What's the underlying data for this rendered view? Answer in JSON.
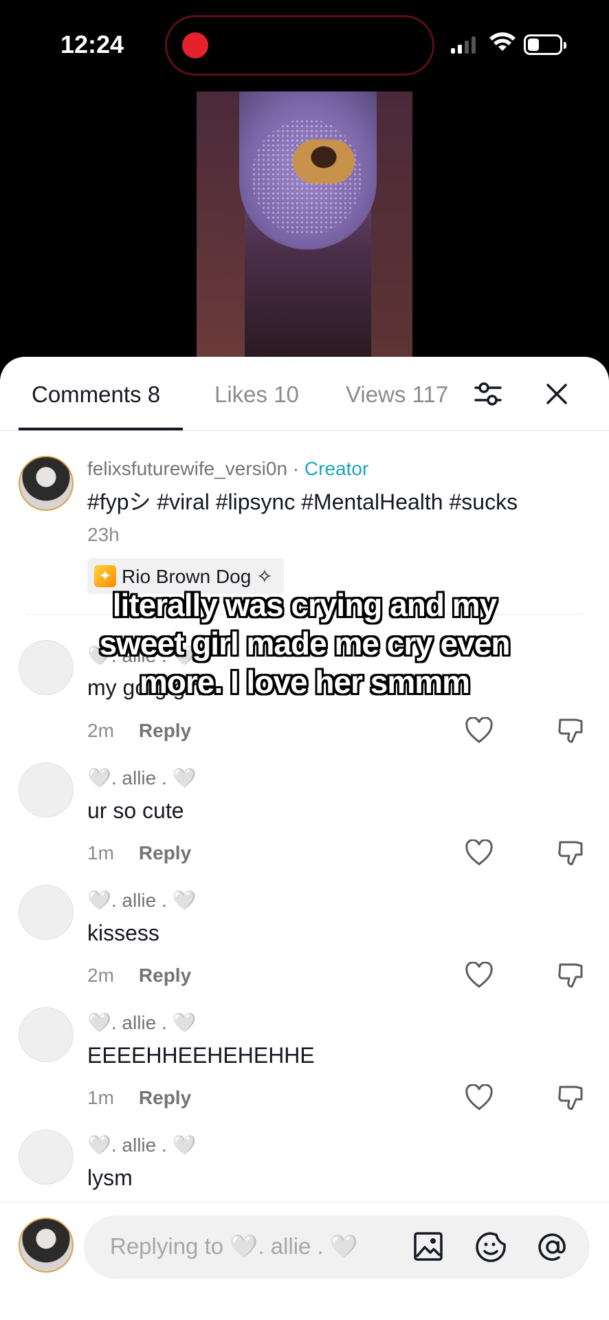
{
  "status_bar": {
    "time": "12:24"
  },
  "tabs": [
    {
      "label": "Comments 8",
      "active": true
    },
    {
      "label": "Likes 10",
      "active": false
    },
    {
      "label": "Views 117",
      "active": false
    }
  ],
  "creator_post": {
    "username": "felixsfuturewife_versi0n",
    "separator": " · ",
    "badge": "Creator",
    "text": "#fypシ #viral #lipsync #MentalHealth #sucks",
    "time": "23h",
    "effect": "Rio Brown Dog ✧"
  },
  "comments": [
    {
      "username": "🤍. allie . 🤍",
      "text": "my gorg girl",
      "time": "2m",
      "reply": "Reply"
    },
    {
      "username": "🤍. allie . 🤍",
      "text": "ur so cute",
      "time": "1m",
      "reply": "Reply"
    },
    {
      "username": "🤍. allie . 🤍",
      "text": "kissess",
      "time": "2m",
      "reply": "Reply"
    },
    {
      "username": "🤍. allie . 🤍",
      "text": "EEEEHHEEHEHEHHE",
      "time": "1m",
      "reply": "Reply"
    },
    {
      "username": "🤍. allie . 🤍",
      "text": "lysm"
    }
  ],
  "caption": "literally was crying and my sweet girl made me cry even more. I love her smmm",
  "composer": {
    "placeholder": "Replying to 🤍. allie . 🤍"
  },
  "colors": {
    "accent_creator": "#1fa6b8",
    "record": "#e5212c",
    "text": "#161823",
    "muted": "#8a8b91"
  }
}
